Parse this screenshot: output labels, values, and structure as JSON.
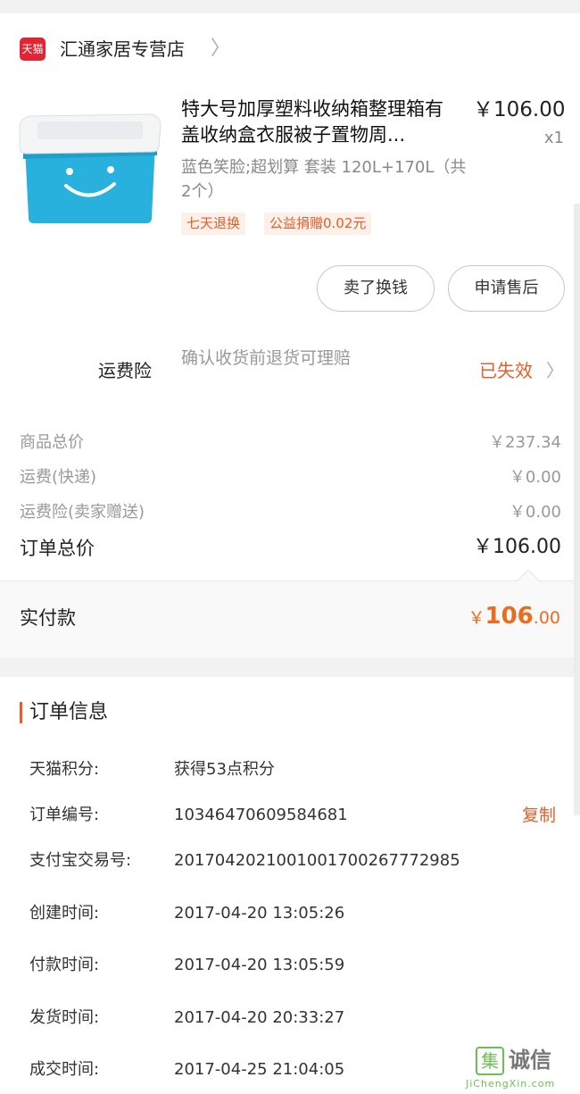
{
  "shop": {
    "logo_text": "天猫",
    "name": "汇通家居专营店",
    "chevron": "〉"
  },
  "product": {
    "title": "特大号加厚塑料收纳箱整理箱有盖收纳盒衣服被子置物周...",
    "price": "￥106.00",
    "qty": "x1",
    "sku": "蓝色笑脸;超划算 套装 120L+170L（共2个）",
    "tags": [
      "七天退换",
      "公益捐赠0.02元"
    ],
    "image_colors": {
      "lid": "#f4f6f6",
      "body": "#27b1dc"
    }
  },
  "actions": {
    "sell": "卖了换钱",
    "after_sale": "申请售后"
  },
  "insurance": {
    "label": "运费险",
    "desc": "确认收货前退货可理赔",
    "status": "已失效",
    "chevron": "〉"
  },
  "summary": {
    "rows": [
      {
        "label": "商品总价",
        "value": "￥237.34"
      },
      {
        "label": "运费(快递)",
        "value": "￥0.00"
      },
      {
        "label": "运费险(卖家赠送)",
        "value": "￥0.00"
      }
    ],
    "total_label": "订单总价",
    "total_value": "￥106.00",
    "paid_label": "实付款",
    "paid_symbol": "￥",
    "paid_int": "106",
    "paid_dec": ".00"
  },
  "order_info": {
    "title": "订单信息",
    "copy": "复制",
    "rows": [
      {
        "label": "天猫积分:",
        "value": "获得53点积分"
      },
      {
        "label": "订单编号:",
        "value": "10346470609584681"
      },
      {
        "label": "支付宝交易号:",
        "value": "2017042021001001700267772985"
      },
      {
        "label": "创建时间:",
        "value": "2017-04-20 13:05:26"
      },
      {
        "label": "付款时间:",
        "value": "2017-04-20 13:05:59"
      },
      {
        "label": "发货时间:",
        "value": "2017-04-20 20:33:27"
      },
      {
        "label": "成交时间:",
        "value": "2017-04-25 21:04:05"
      }
    ]
  },
  "watermark": {
    "box": "集",
    "text": "诚信",
    "url": "JiChengXin.com"
  },
  "colors": {
    "accent": "#e2602b",
    "price_accent": "#ec6c1f",
    "tmall_red": "#e02534"
  }
}
